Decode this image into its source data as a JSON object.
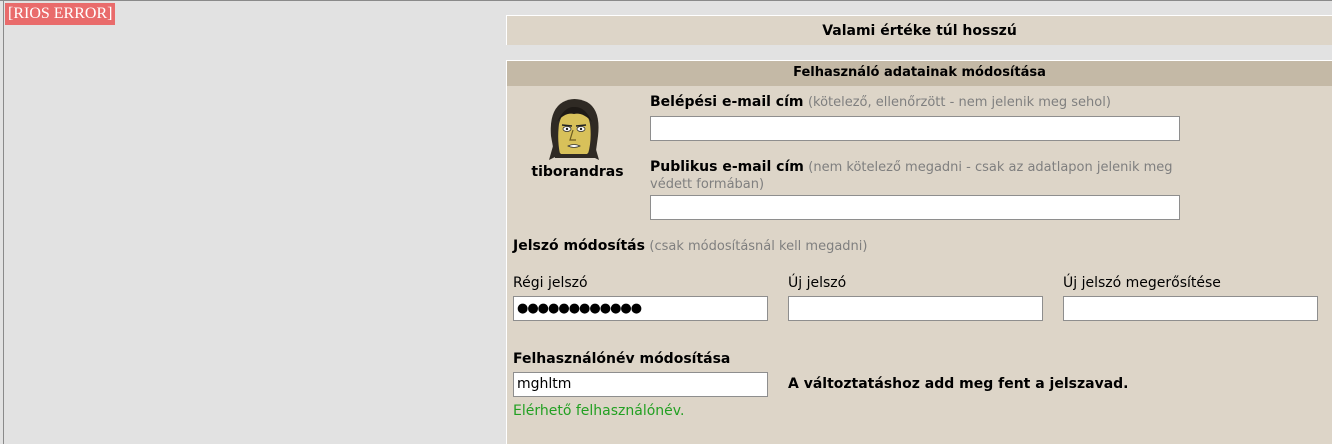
{
  "rios_error": "[RIOS ERROR]",
  "error_message": "Valami értéke túl hosszú",
  "panel": {
    "title": "Felhasználó adatainak módosítása",
    "username": "tiborandras"
  },
  "login_email": {
    "label": "Belépési e-mail cím",
    "hint": "(kötelező, ellenőrzött - nem jelenik meg sehol)",
    "value": ""
  },
  "public_email": {
    "label": "Publikus e-mail cím",
    "hint": "(nem kötelező megadni - csak az adatlapon jelenik meg védett formában)",
    "value": ""
  },
  "password": {
    "section_label": "Jelszó módosítás",
    "section_hint": "(csak módosításnál kell megadni)",
    "old_label": "Régi jelszó",
    "old_value": "●●●●●●●●●●●●",
    "new_label": "Új jelszó",
    "new_value": "",
    "confirm_label": "Új jelszó megerősítése",
    "confirm_value": ""
  },
  "username_change": {
    "label": "Felhasználónév módosítása",
    "value": "mghltm",
    "notice": "A változtatáshoz add meg fent a jelszavad.",
    "status": "Elérhető felhasználónév.",
    "status_color": "#22a022"
  },
  "icons": {
    "avatar": "caricature-avatar-icon"
  }
}
